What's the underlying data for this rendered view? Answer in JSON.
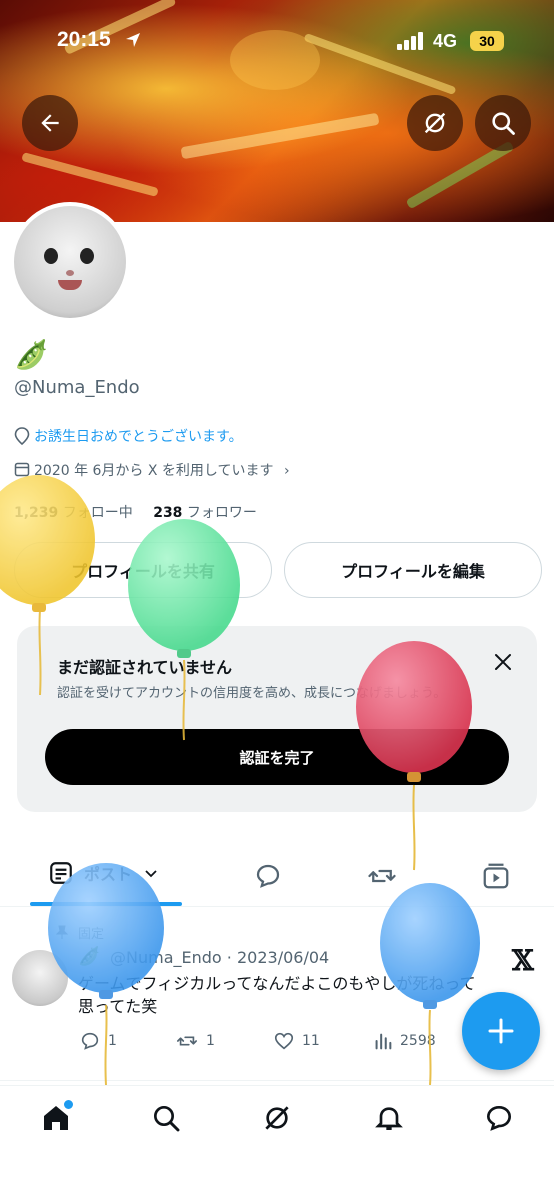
{
  "status": {
    "time": "20:15",
    "network": "4G",
    "battery": "30"
  },
  "header": {
    "back_icon": "arrow-left-icon",
    "grok_icon": "grok-icon",
    "search_icon": "search-icon"
  },
  "profile": {
    "display_name_emoji": "🫛",
    "handle": "@Numa_Endo",
    "birthday_text": "お誘生日おめでとうございます。",
    "joined_text": "2020 年 6月から X を利用しています",
    "following_count": "1,239",
    "following_label": "フォロー中",
    "followers_count": "238",
    "followers_label": "フォロワー",
    "share_button": "プロフィールを共有",
    "edit_button": "プロフィールを編集"
  },
  "verify_card": {
    "title": "まだ認証されていません",
    "description": "認証を受けてアカウントの信用度を高め、成長につなげましょう。",
    "button": "認証を完了"
  },
  "tabs": [
    {
      "label": "ポスト",
      "icon": "posts-icon",
      "active": true
    },
    {
      "icon": "replies-icon"
    },
    {
      "icon": "reposts-icon"
    },
    {
      "icon": "media-icon"
    }
  ],
  "post": {
    "pinned_label": "固定",
    "author_emoji": "🫛",
    "author_handle": "@Numa_Endo",
    "date": "2023/06/04",
    "text": "ゲームでフィジカルってなんだよこのもやしが死ねって思ってた笑",
    "replies": "1",
    "reposts": "1",
    "likes": "11",
    "views": "2598"
  },
  "colors": {
    "accent": "#1d9bf0",
    "text": "#0f1419",
    "muted": "#536471"
  },
  "nav": [
    "home-icon",
    "search-icon",
    "grok-icon",
    "notifications-icon",
    "messages-icon"
  ]
}
